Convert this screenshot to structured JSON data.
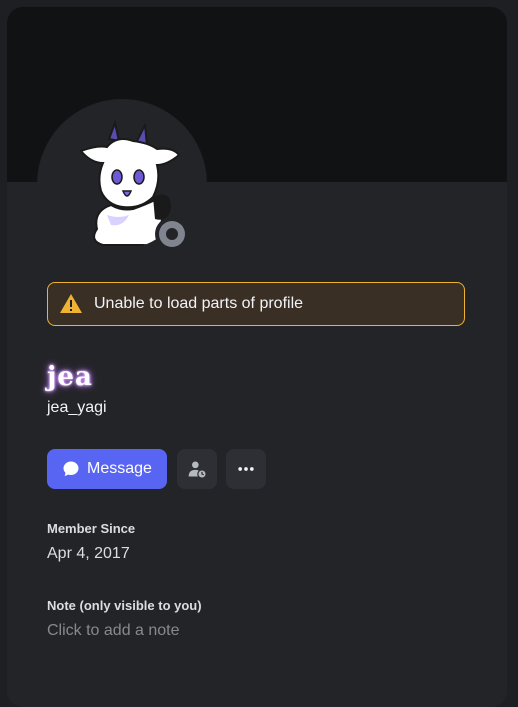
{
  "profile": {
    "display_name": "jea",
    "username": "jea_yagi",
    "status": "offline"
  },
  "warning": {
    "icon": "warning-triangle-icon",
    "text": "Unable to load parts of profile",
    "border_color": "#f0b232",
    "icon_color": "#f0b232"
  },
  "actions": {
    "message_label": "Message",
    "message_icon": "chat-bubble-icon",
    "friend_icon": "pending-friend-icon",
    "more_icon": "more-horizontal-icon"
  },
  "sections": {
    "member_since_title": "Member Since",
    "member_since_value": "Apr 4, 2017",
    "note_title": "Note (only visible to you)",
    "note_placeholder": "Click to add a note"
  },
  "colors": {
    "accent": "#5865f2",
    "background": "#232428",
    "banner": "#111214",
    "status_offline": "#80848e"
  }
}
